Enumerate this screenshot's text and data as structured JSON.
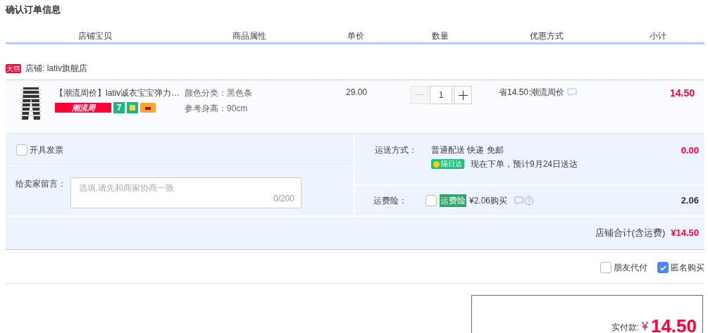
{
  "title": "确认订单信息",
  "columns": [
    "店铺宝贝",
    "商品属性",
    "单价",
    "数量",
    "优惠方式",
    "小计"
  ],
  "store": {
    "badge": "天猫",
    "label": "店铺: lativ旗舰店"
  },
  "item": {
    "name": "【潮流周价】lativ诚衣宝宝弹力…",
    "promo_tag": "潮流周",
    "service_badge": "7",
    "attributes": [
      "颜色分类：黑色条",
      "参考身高：90cm"
    ],
    "price": "29.00",
    "quantity": "1",
    "discount": "省14.50:潮流周价",
    "subtotal": "14.50"
  },
  "invoice": {
    "label": "开具发票",
    "checked": false
  },
  "message": {
    "label": "给卖家留言：",
    "placeholder": "选填,请先和商家协商一致",
    "counter": "0/200"
  },
  "shipping": {
    "label": "运送方式：",
    "method": "普通配送 快递 免邮",
    "badge": "隔日达",
    "eta": "现在下单，预计9月24日送达",
    "amount": "0.00"
  },
  "insurance": {
    "label": "运费险：",
    "checked": false,
    "tag": "运费险",
    "price": "¥2.06购买",
    "amount": "2.06"
  },
  "store_total": {
    "label": "店铺合计(含运费)",
    "amount": "¥14.50"
  },
  "options": [
    {
      "label": "朋友代付",
      "checked": false
    },
    {
      "label": "匿名购买",
      "checked": true
    }
  ],
  "payment": {
    "label": "实付款:",
    "currency": "¥",
    "amount": "14.50"
  }
}
